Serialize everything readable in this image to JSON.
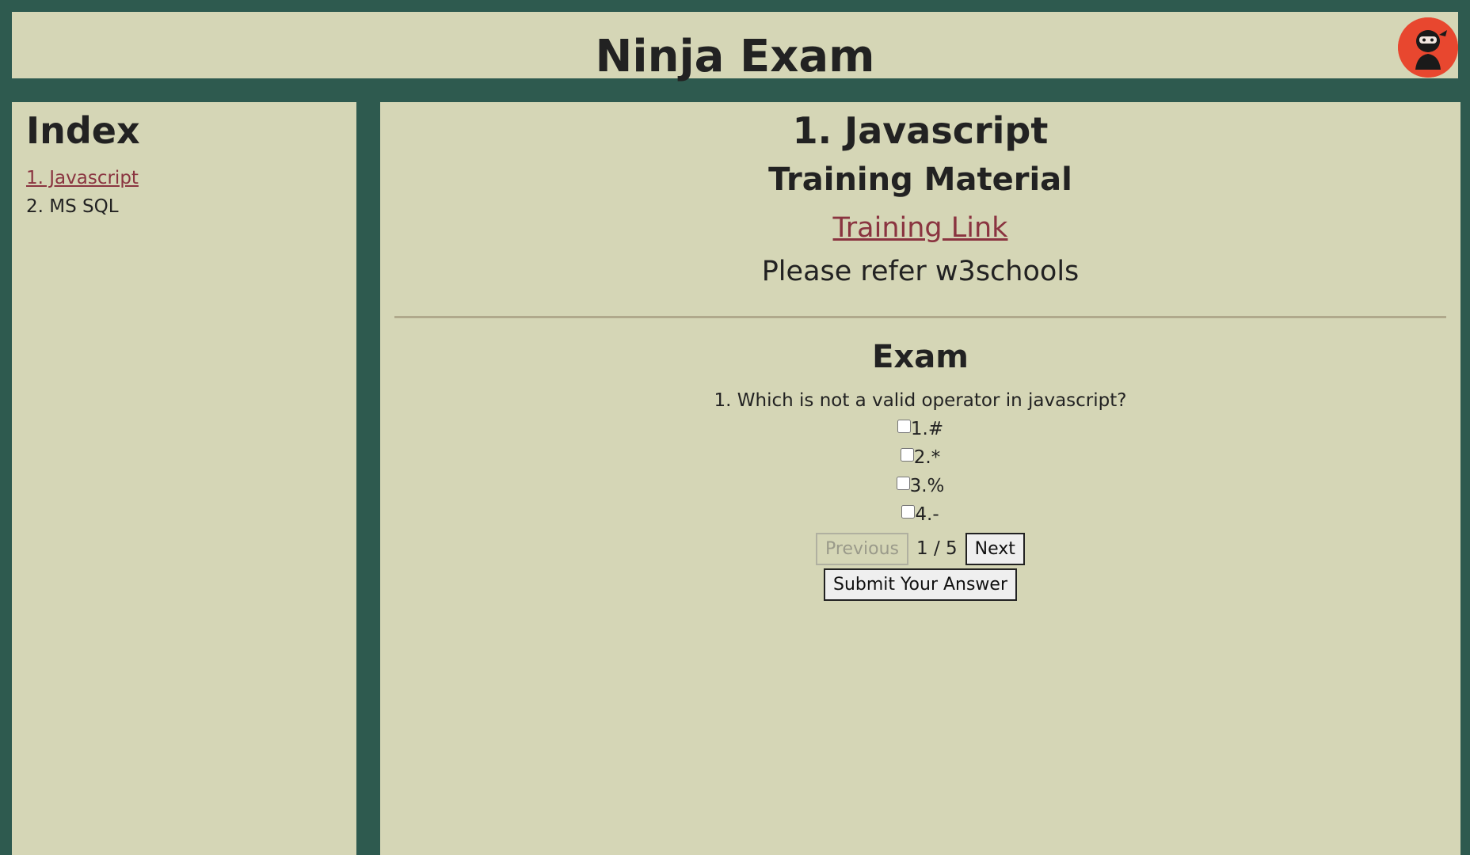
{
  "header": {
    "title": "Ninja Exam"
  },
  "sidebar": {
    "title": "Index",
    "items": [
      {
        "label": "1. Javascript",
        "active": true
      },
      {
        "label": "2. MS SQL",
        "active": false
      }
    ]
  },
  "main": {
    "topic_title": "1. Javascript",
    "material_title": "Training Material",
    "training_link": "Training Link",
    "note": "Please refer w3schools",
    "exam_title": "Exam",
    "question": "1. Which is not a valid operator in javascript?",
    "options": [
      "1.#",
      "2.*",
      "3.%",
      "4.-"
    ],
    "pager": {
      "previous_label": "Previous",
      "count": "1 / 5",
      "next_label": "Next"
    },
    "submit_label": "Submit Your Answer"
  },
  "colors": {
    "background": "#2e5a4f",
    "panel": "#d5d6b6",
    "link": "#8a3440",
    "avatar": "#e8472f"
  },
  "icons": {
    "avatar": "ninja-icon"
  }
}
